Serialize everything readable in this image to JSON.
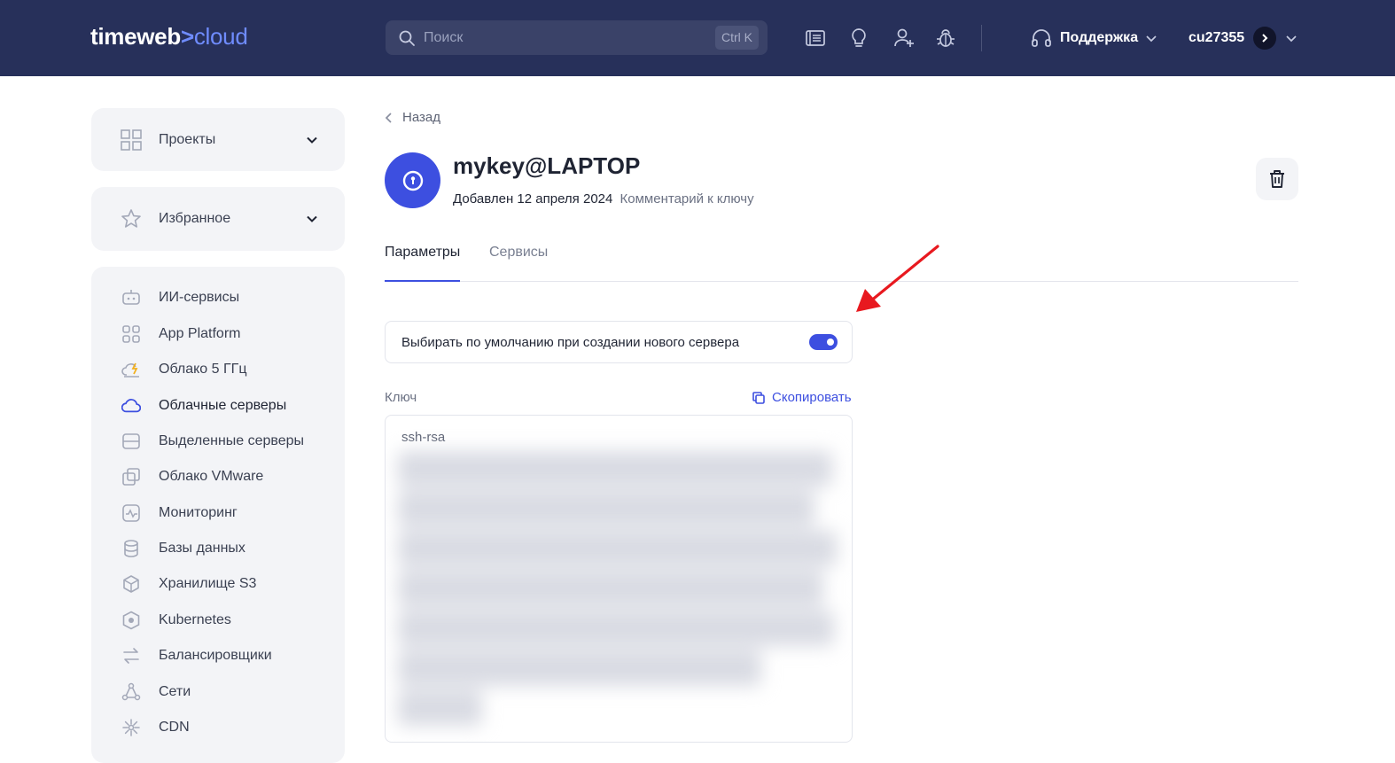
{
  "header": {
    "logo_part1": "timeweb",
    "logo_arrow": ">",
    "logo_part2": "cloud",
    "search_placeholder": "Поиск",
    "search_shortcut": "Ctrl K",
    "icons": [
      "docs-icon",
      "lightbulb-icon",
      "add-user-icon",
      "bug-icon"
    ],
    "support_label": "Поддержка",
    "username": "cu27355"
  },
  "sidebar": {
    "projects_label": "Проекты",
    "favorites_label": "Избранное",
    "items": [
      {
        "label": "ИИ-сервисы",
        "icon": "robot-icon"
      },
      {
        "label": "App Platform",
        "icon": "grid-icon"
      },
      {
        "label": "Облако 5 ГГц",
        "icon": "cloud-lightning-icon"
      },
      {
        "label": "Облачные серверы",
        "icon": "cloud-icon",
        "active": true
      },
      {
        "label": "Выделенные серверы",
        "icon": "server-icon"
      },
      {
        "label": "Облако VMware",
        "icon": "vmware-icon"
      },
      {
        "label": "Мониторинг",
        "icon": "monitoring-icon"
      },
      {
        "label": "Базы данных",
        "icon": "database-icon"
      },
      {
        "label": "Хранилище S3",
        "icon": "storage-cube-icon"
      },
      {
        "label": "Kubernetes",
        "icon": "kubernetes-icon"
      },
      {
        "label": "Балансировщики",
        "icon": "balancer-icon"
      },
      {
        "label": "Сети",
        "icon": "network-icon"
      },
      {
        "label": "CDN",
        "icon": "cdn-icon"
      }
    ]
  },
  "main": {
    "back_label": "Назад",
    "key_name": "mykey@LAPTOP",
    "added_text": "Добавлен 12 апреля 2024",
    "comment_text": "Комментарий к ключу",
    "tabs": [
      {
        "label": "Параметры",
        "active": true
      },
      {
        "label": "Сервисы",
        "active": false
      }
    ],
    "default_toggle_label": "Выбирать по умолчанию при создании нового сервера",
    "default_toggle_on": true,
    "key_label": "Ключ",
    "copy_label": "Скопировать",
    "key_prefix": "ssh-rsa"
  },
  "colors": {
    "header_bg": "#27305a",
    "accent": "#3d4fe0",
    "sidebar_bg": "#f3f4f7",
    "annotation": "#e8191f"
  }
}
